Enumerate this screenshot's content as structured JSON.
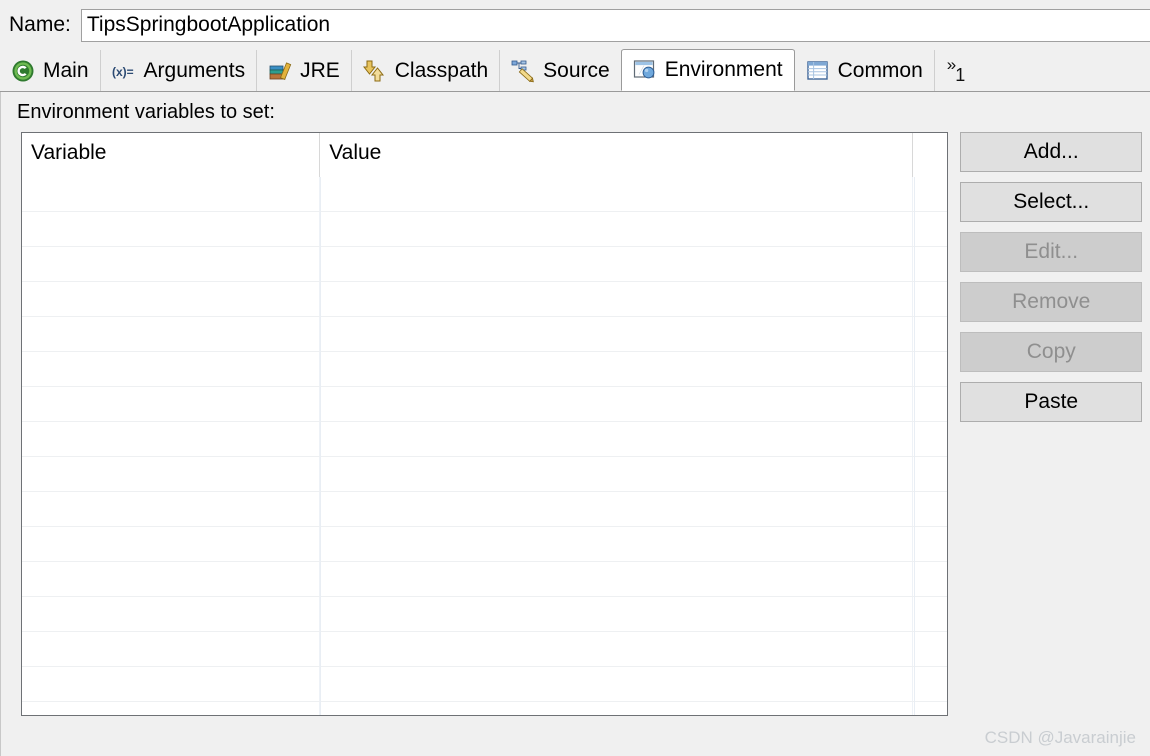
{
  "name_field": {
    "label": "Name:",
    "value": "TipsSpringbootApplication"
  },
  "tabs": [
    {
      "label": "Main",
      "icon": "java-main-icon",
      "active": false
    },
    {
      "label": "Arguments",
      "icon": "variable-icon",
      "active": false
    },
    {
      "label": "JRE",
      "icon": "books-icon",
      "active": false
    },
    {
      "label": "Classpath",
      "icon": "arrows-icon",
      "active": false
    },
    {
      "label": "Source",
      "icon": "source-tree-icon",
      "active": false
    },
    {
      "label": "Environment",
      "icon": "environment-icon",
      "active": true
    },
    {
      "label": "Common",
      "icon": "table-icon",
      "active": false
    }
  ],
  "tab_overflow": {
    "chevron": "»",
    "count": "1"
  },
  "section": {
    "label": "Environment variables to set:"
  },
  "table": {
    "columns": [
      "Variable",
      "Value",
      ""
    ],
    "rows": []
  },
  "buttons": [
    {
      "label": "Add...",
      "enabled": true
    },
    {
      "label": "Select...",
      "enabled": true
    },
    {
      "label": "Edit...",
      "enabled": false
    },
    {
      "label": "Remove",
      "enabled": false
    },
    {
      "label": "Copy",
      "enabled": false
    },
    {
      "label": "Paste",
      "enabled": true
    }
  ],
  "watermark": "CSDN @Javarainjie",
  "colors": {
    "window_bg": "#f0f0f0",
    "table_bg": "#ffffff",
    "button_bg": "#e0e0e0",
    "button_disabled_bg": "#cdcdcd",
    "button_disabled_text": "#8f8f8f",
    "border": "#6e7175",
    "watermark": "#c9cdd1"
  }
}
